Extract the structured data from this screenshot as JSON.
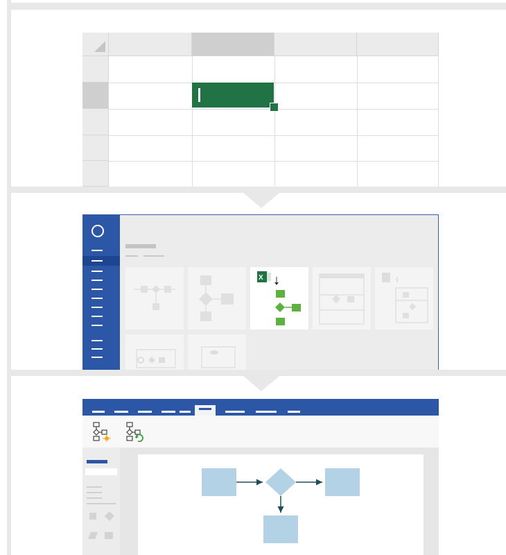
{
  "steps": [
    "excel-data",
    "visio-data-visualizer-template",
    "visio-generated-diagram"
  ],
  "colors": {
    "excel_green": "#217346",
    "visio_blue": "#2b57a6",
    "flow_shape": "#b4d2e5",
    "connector": "#1e4d5c",
    "panel_separator": "#e8e8e8"
  },
  "icons": {
    "create_diagram": "flowchart-sparkle-icon",
    "refresh_diagram": "flowchart-refresh-icon"
  }
}
